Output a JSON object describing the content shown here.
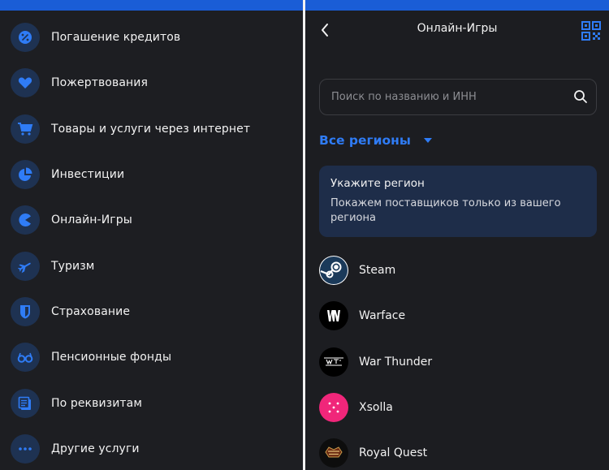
{
  "left_menu": {
    "items": [
      {
        "label": "Погашение кредитов",
        "icon": "percent-icon"
      },
      {
        "label": "Пожертвования",
        "icon": "heart-icon"
      },
      {
        "label": "Товары и услуги через интернет",
        "icon": "cart-icon"
      },
      {
        "label": "Инвестиции",
        "icon": "pie-chart-icon"
      },
      {
        "label": "Онлайн-Игры",
        "icon": "pacman-icon"
      },
      {
        "label": "Туризм",
        "icon": "airplane-icon"
      },
      {
        "label": "Страхование",
        "icon": "shield-icon"
      },
      {
        "label": "Пенсионные фонды",
        "icon": "glasses-icon"
      },
      {
        "label": "По реквизитам",
        "icon": "document-icon"
      },
      {
        "label": "Другие услуги",
        "icon": "more-dots-icon"
      }
    ]
  },
  "header": {
    "title": "Онлайн-Игры"
  },
  "search": {
    "placeholder": "Поиск по названию и ИНН"
  },
  "region": {
    "label": "Все регионы"
  },
  "info_card": {
    "title": "Укажите регион",
    "text": "Покажем поставщиков только из вашего региона"
  },
  "providers": [
    {
      "name": "Steam",
      "icon": "steam-logo"
    },
    {
      "name": "Warface",
      "icon": "warface-logo"
    },
    {
      "name": "War Thunder",
      "icon": "war-thunder-logo"
    },
    {
      "name": "Xsolla",
      "icon": "xsolla-logo"
    },
    {
      "name": "Royal Quest",
      "icon": "royal-quest-logo"
    }
  ],
  "colors": {
    "accent": "#2f7cf6",
    "top_bar": "#1a5dd6",
    "icon_circle": "#1e3252",
    "card_bg": "#1e2d49",
    "xsolla_pink": "#f0267a"
  }
}
